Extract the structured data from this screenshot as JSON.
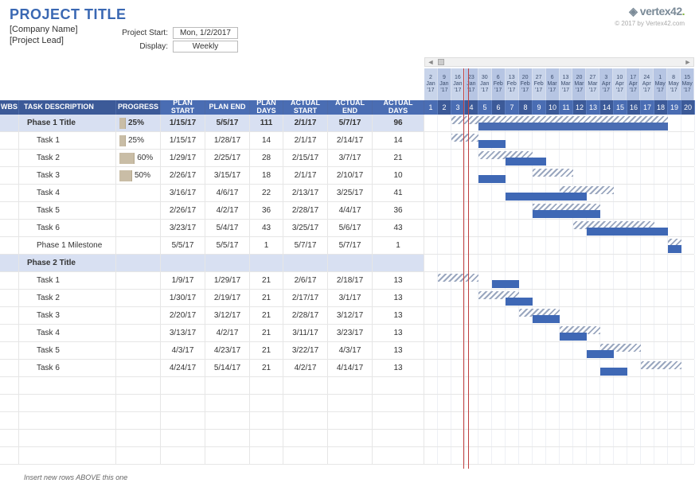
{
  "header": {
    "project_title": "PROJECT TITLE",
    "company": "[Company Name]",
    "lead": "[Project Lead]",
    "start_label": "Project Start:",
    "start_value": "Mon, 1/2/2017",
    "display_label": "Display:",
    "display_value": "Weekly",
    "logo_text": "vertex42",
    "copyright": "© 2017 by Vertex42.com"
  },
  "columns": {
    "wbs": "WBS",
    "task": "TASK DESCRIPTION",
    "progress": "PROGRESS",
    "plan_start": "PLAN START",
    "plan_end": "PLAN END",
    "plan_days": "PLAN DAYS",
    "actual_start": "ACTUAL START",
    "actual_end": "ACTUAL END",
    "actual_days": "ACTUAL DAYS"
  },
  "timeline": {
    "dates": [
      {
        "d": "2",
        "m": "Jan",
        "y": "'17"
      },
      {
        "d": "9",
        "m": "Jan",
        "y": "'17"
      },
      {
        "d": "16",
        "m": "Jan",
        "y": "'17"
      },
      {
        "d": "23",
        "m": "Jan",
        "y": "'17"
      },
      {
        "d": "30",
        "m": "Jan",
        "y": "'17"
      },
      {
        "d": "6",
        "m": "Feb",
        "y": "'17"
      },
      {
        "d": "13",
        "m": "Feb",
        "y": "'17"
      },
      {
        "d": "20",
        "m": "Feb",
        "y": "'17"
      },
      {
        "d": "27",
        "m": "Feb",
        "y": "'17"
      },
      {
        "d": "6",
        "m": "Mar",
        "y": "'17"
      },
      {
        "d": "13",
        "m": "Mar",
        "y": "'17"
      },
      {
        "d": "20",
        "m": "Mar",
        "y": "'17"
      },
      {
        "d": "27",
        "m": "Mar",
        "y": "'17"
      },
      {
        "d": "3",
        "m": "Apr",
        "y": "'17"
      },
      {
        "d": "10",
        "m": "Apr",
        "y": "'17"
      },
      {
        "d": "17",
        "m": "Apr",
        "y": "'17"
      },
      {
        "d": "24",
        "m": "Apr",
        "y": "'17"
      },
      {
        "d": "1",
        "m": "May",
        "y": "'17"
      },
      {
        "d": "8",
        "m": "May",
        "y": "'17"
      },
      {
        "d": "15",
        "m": "May",
        "y": "'17"
      }
    ],
    "weeks": [
      "1",
      "2",
      "3",
      "4",
      "5",
      "6",
      "7",
      "8",
      "9",
      "10",
      "11",
      "12",
      "13",
      "14",
      "15",
      "16",
      "17",
      "18",
      "19",
      "20"
    ]
  },
  "tasks": [
    {
      "name": "Phase 1 Title",
      "phase": true,
      "progress": "25%",
      "pbar": 25,
      "ps": "1/15/17",
      "pe": "5/5/17",
      "pd": "111",
      "as": "2/1/17",
      "ae": "5/7/17",
      "ad": "96",
      "plan": [
        2,
        16
      ],
      "actual": [
        4,
        14
      ]
    },
    {
      "name": "Task 1",
      "progress": "25%",
      "pbar": 25,
      "ps": "1/15/17",
      "pe": "1/28/17",
      "pd": "14",
      "as": "2/1/17",
      "ae": "2/14/17",
      "ad": "14",
      "plan": [
        2,
        2
      ],
      "actual": [
        4,
        2
      ]
    },
    {
      "name": "Task 2",
      "progress": "60%",
      "pbar": 60,
      "ps": "1/29/17",
      "pe": "2/25/17",
      "pd": "28",
      "as": "2/15/17",
      "ae": "3/7/17",
      "ad": "21",
      "plan": [
        4,
        4
      ],
      "actual": [
        6,
        3
      ]
    },
    {
      "name": "Task 3",
      "progress": "50%",
      "pbar": 50,
      "ps": "2/26/17",
      "pe": "3/15/17",
      "pd": "18",
      "as": "2/1/17",
      "ae": "2/10/17",
      "ad": "10",
      "plan": [
        8,
        3
      ],
      "actual": [
        4,
        2
      ]
    },
    {
      "name": "Task 4",
      "ps": "3/16/17",
      "pe": "4/6/17",
      "pd": "22",
      "as": "2/13/17",
      "ae": "3/25/17",
      "ad": "41",
      "plan": [
        10,
        4
      ],
      "actual": [
        6,
        6
      ]
    },
    {
      "name": "Task 5",
      "ps": "2/26/17",
      "pe": "4/2/17",
      "pd": "36",
      "as": "2/28/17",
      "ae": "4/4/17",
      "ad": "36",
      "plan": [
        8,
        5
      ],
      "actual": [
        8,
        5
      ]
    },
    {
      "name": "Task 6",
      "ps": "3/23/17",
      "pe": "5/4/17",
      "pd": "43",
      "as": "3/25/17",
      "ae": "5/6/17",
      "ad": "43",
      "plan": [
        11,
        6
      ],
      "actual": [
        12,
        6
      ]
    },
    {
      "name": "Phase 1 Milestone",
      "ps": "5/5/17",
      "pe": "5/5/17",
      "pd": "1",
      "as": "5/7/17",
      "ae": "5/7/17",
      "ad": "1",
      "plan": [
        18,
        1
      ],
      "actual": [
        18,
        1
      ]
    },
    {
      "name": "Phase 2 Title",
      "phase": true
    },
    {
      "name": "Task 1",
      "ps": "1/9/17",
      "pe": "1/29/17",
      "pd": "21",
      "as": "2/6/17",
      "ae": "2/18/17",
      "ad": "13",
      "plan": [
        1,
        3
      ],
      "actual": [
        5,
        2
      ]
    },
    {
      "name": "Task 2",
      "ps": "1/30/17",
      "pe": "2/19/17",
      "pd": "21",
      "as": "2/17/17",
      "ae": "3/1/17",
      "ad": "13",
      "plan": [
        4,
        3
      ],
      "actual": [
        6,
        2
      ]
    },
    {
      "name": "Task 3",
      "ps": "2/20/17",
      "pe": "3/12/17",
      "pd": "21",
      "as": "2/28/17",
      "ae": "3/12/17",
      "ad": "13",
      "plan": [
        7,
        3
      ],
      "actual": [
        8,
        2
      ]
    },
    {
      "name": "Task 4",
      "ps": "3/13/17",
      "pe": "4/2/17",
      "pd": "21",
      "as": "3/11/17",
      "ae": "3/23/17",
      "ad": "13",
      "plan": [
        10,
        3
      ],
      "actual": [
        10,
        2
      ]
    },
    {
      "name": "Task 5",
      "ps": "4/3/17",
      "pe": "4/23/17",
      "pd": "21",
      "as": "3/22/17",
      "ae": "4/3/17",
      "ad": "13",
      "plan": [
        13,
        3
      ],
      "actual": [
        12,
        2
      ]
    },
    {
      "name": "Task 6",
      "ps": "4/24/17",
      "pe": "5/14/17",
      "pd": "21",
      "as": "4/2/17",
      "ae": "4/14/17",
      "ad": "13",
      "plan": [
        16,
        3
      ],
      "actual": [
        13,
        2
      ]
    }
  ],
  "empty_rows": 5,
  "footer_note": "Insert new rows ABOVE this one",
  "today_marker_week": 3
}
